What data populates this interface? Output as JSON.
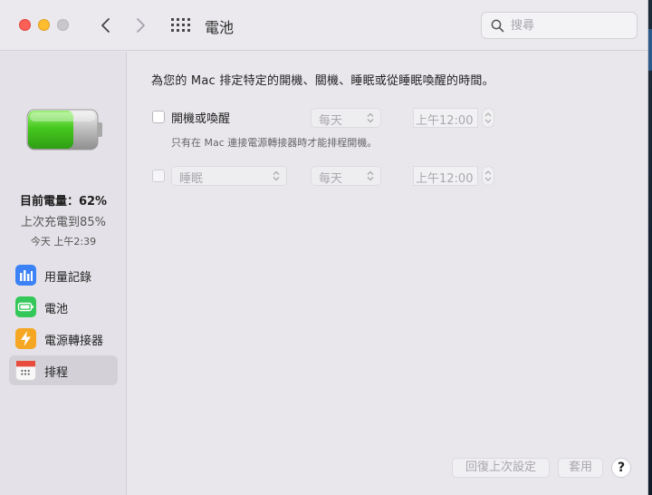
{
  "window": {
    "title": "電池"
  },
  "search": {
    "placeholder": "搜尋",
    "value": ""
  },
  "sidebar": {
    "charge_now": "目前電量：62%",
    "last_charge": "上次充電到85%",
    "time": "今天 上午2:39",
    "items": [
      {
        "label": "用量記錄",
        "icon": "usage-history-icon",
        "color": "#3b82f6"
      },
      {
        "label": "電池",
        "icon": "battery-icon",
        "color": "#34c759"
      },
      {
        "label": "電源轉接器",
        "icon": "power-adapter-icon",
        "color": "#f5a623"
      },
      {
        "label": "排程",
        "icon": "calendar-icon",
        "color": "#e84c3d"
      }
    ],
    "selected": 3
  },
  "main": {
    "headline": "為您的 Mac 排定特定的開機、關機、睡眠或從睡眠喚醒的時間。",
    "rows": [
      {
        "label": "開機或喚醒",
        "frequency": "每天",
        "time": "上午12:00",
        "checked": false
      },
      {
        "action": "睡眠",
        "frequency": "每天",
        "time": "上午12:00",
        "checked": false
      }
    ],
    "note": "只有在 Mac 連接電源轉接器時才能排程開機。"
  },
  "footer": {
    "revert_label": "回復上次設定",
    "apply_label": "套用",
    "help_label": "?"
  },
  "colors": {
    "battery_fill": "#4cd137",
    "accent": "#007aff"
  }
}
